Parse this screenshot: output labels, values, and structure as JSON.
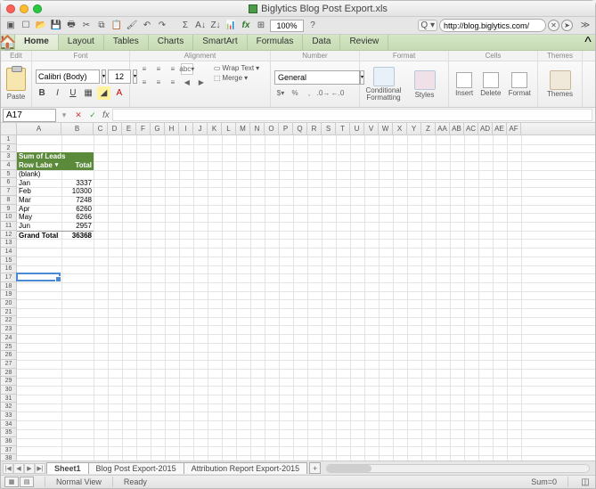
{
  "window": {
    "title": "Biglytics Blog Post Export.xls"
  },
  "toolbar": {
    "zoom": "100%",
    "url": "http://blog.biglytics.com/"
  },
  "ribbon": {
    "tabs": [
      "Home",
      "Layout",
      "Tables",
      "Charts",
      "SmartArt",
      "Formulas",
      "Data",
      "Review"
    ],
    "groups": [
      "Edit",
      "Font",
      "Alignment",
      "Number",
      "Format",
      "Cells",
      "Themes"
    ],
    "paste": "Paste",
    "font_name": "Calibri (Body)",
    "font_size": "12",
    "wrap": "Wrap Text",
    "merge": "Merge",
    "number_format": "General",
    "cond_fmt": "Conditional Formatting",
    "styles": "Styles",
    "insert": "Insert",
    "delete": "Delete",
    "format": "Format",
    "themes": "Themes"
  },
  "namebox": {
    "ref": "A17"
  },
  "columns": [
    "A",
    "B",
    "C",
    "D",
    "E",
    "F",
    "G",
    "H",
    "I",
    "J",
    "K",
    "L",
    "M",
    "N",
    "O",
    "P",
    "Q",
    "R",
    "S",
    "T",
    "U",
    "V",
    "W",
    "X",
    "Y",
    "Z",
    "AA",
    "AB",
    "AC",
    "AD",
    "AE",
    "AF"
  ],
  "pivot": {
    "value_field": "Sum of Leads",
    "row_label_header": "Row Labels",
    "total_header": "Total",
    "rows": [
      {
        "label": "(blank)",
        "val": ""
      },
      {
        "label": "Jan",
        "val": "3337"
      },
      {
        "label": "Feb",
        "val": "10300"
      },
      {
        "label": "Mar",
        "val": "7248"
      },
      {
        "label": "Apr",
        "val": "6260"
      },
      {
        "label": "May",
        "val": "6266"
      },
      {
        "label": "Jun",
        "val": "2957"
      }
    ],
    "grand_label": "Grand Total",
    "grand_val": "36368"
  },
  "sheets": {
    "tabs": [
      "Sheet1",
      "Blog Post Export-2015",
      "Attribution Report Export-2015"
    ]
  },
  "status": {
    "view": "Normal View",
    "state": "Ready",
    "sum": "Sum=0"
  },
  "chart_data": {
    "type": "table",
    "title": "Sum of Leads",
    "columns": [
      "Row Labels",
      "Total"
    ],
    "rows": [
      [
        "(blank)",
        null
      ],
      [
        "Jan",
        3337
      ],
      [
        "Feb",
        10300
      ],
      [
        "Mar",
        7248
      ],
      [
        "Apr",
        6260
      ],
      [
        "May",
        6266
      ],
      [
        "Jun",
        2957
      ],
      [
        "Grand Total",
        36368
      ]
    ]
  }
}
